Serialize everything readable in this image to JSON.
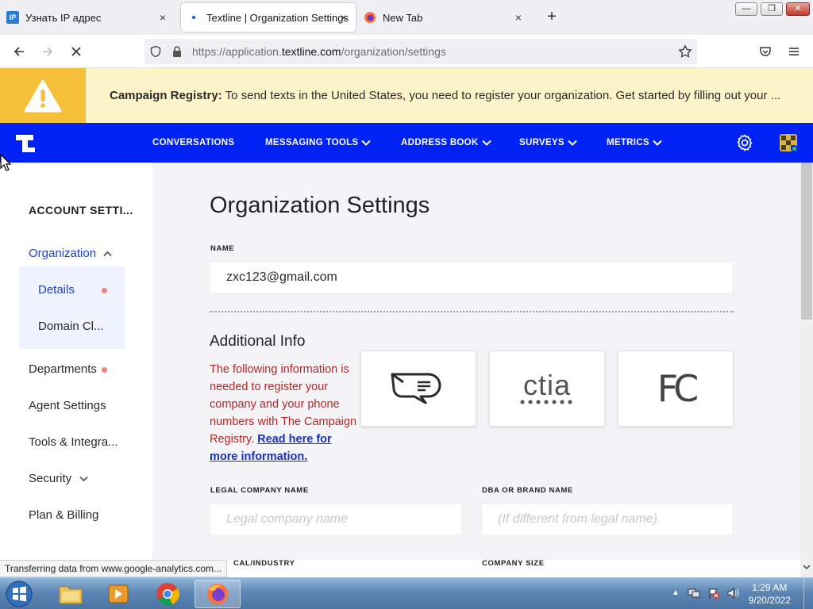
{
  "browser": {
    "tabs": [
      {
        "title": "Узнать IP адрес",
        "favicon": "IP"
      },
      {
        "title": "Textline | Organization Settings"
      },
      {
        "title": "New Tab"
      }
    ],
    "new_tab_symbol": "+",
    "close_symbol": "×",
    "url": {
      "prefix": "https://application.",
      "host": "textline.com",
      "path": "/organization/settings"
    }
  },
  "banner": {
    "label": "Campaign Registry:",
    "text": " To send texts in the United States, you need to register your organization. Get started by filling out your ...",
    "icon": "warning-icon"
  },
  "appnav": {
    "items": [
      {
        "label": "CONVERSATIONS"
      },
      {
        "label": "MESSAGING TOOLS"
      },
      {
        "label": "ADDRESS BOOK"
      },
      {
        "label": "SURVEYS"
      },
      {
        "label": "METRICS"
      }
    ],
    "brand_color": "#0023f5"
  },
  "sidebar": {
    "title": "ACCOUNT SETTI...",
    "organization": "Organization",
    "details": "Details",
    "domain": "Domain Cl...",
    "departments": "Departments",
    "agent_settings": "Agent Settings",
    "tools": "Tools & Integra...",
    "security": "Security",
    "plan": "Plan & Billing"
  },
  "main": {
    "title": "Organization Settings",
    "name_label": "NAME",
    "name_value": "zxc123@gmail.com",
    "additional_title": "Additional Info",
    "additional_text": "The following information is needed to register your company and your phone numbers with The Campaign Registry. ",
    "additional_link": "Read here for more information.",
    "legal_label": "LEGAL COMPANY NAME",
    "legal_placeholder": "Legal company name",
    "dba_label": "DBA OR BRAND NAME",
    "dba_placeholder": "(If different from legal name)",
    "vertical_label": "CAL/INDUSTRY",
    "size_label": "COMPANY SIZE",
    "logos": [
      "campaign-registry-logo",
      "ctia-logo",
      "fcc-logo"
    ],
    "ctia_text": "ctia",
    "fcc_text": "FC",
    "error_color": "#b5292b"
  },
  "status_text": "Transferring data from www.google-analytics.com...",
  "taskbar": {
    "time": "1:29 AM",
    "date": "9/20/2022"
  }
}
